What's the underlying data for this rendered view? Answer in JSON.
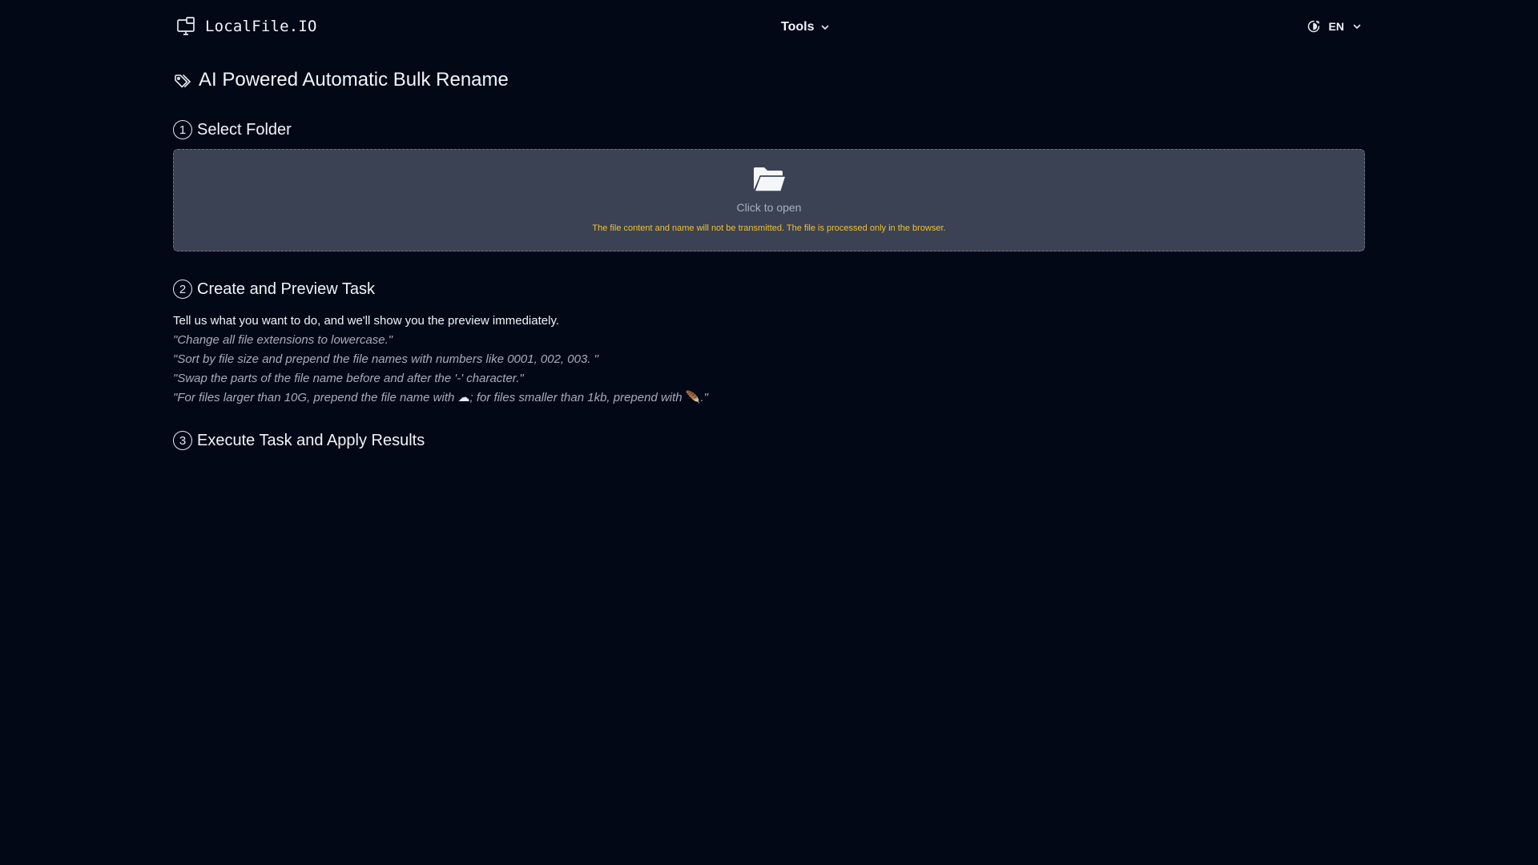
{
  "header": {
    "logo_text": "LocalFile.IO",
    "tools_label": "Tools",
    "language_label": "EN"
  },
  "main": {
    "title": "AI Powered Automatic Bulk Rename",
    "sections": [
      {
        "number": "1",
        "title": "Select Folder"
      },
      {
        "number": "2",
        "title": "Create and Preview Task"
      },
      {
        "number": "3",
        "title": "Execute Task and Apply Results"
      }
    ],
    "dropzone": {
      "label": "Click to open",
      "note": "The file content and name will not be transmitted. The file is processed only in the browser."
    },
    "task": {
      "intro": "Tell us what you want to do, and we'll show you the preview immediately.",
      "examples": [
        "\"Change all file extensions to lowercase.\"",
        "\"Sort by file size and prepend the file names with numbers like 0001, 002, 003. \"",
        "\"Swap the parts of the file name before and after the '-' character.\""
      ],
      "example4_before": "\"For files larger than 10G, prepend the file name with ",
      "example4_icon1": "☁",
      "example4_middle": "; for files smaller than 1kb, prepend with ",
      "example4_icon2": "🪶",
      "example4_after": ".\""
    }
  },
  "colors": {
    "background": "#030816",
    "dropzone": "#3a4253",
    "note": "#f2c12e",
    "example_text": "#a6adba"
  },
  "icons": {
    "logo": "computer-monitor-icon",
    "title": "tags-icon",
    "dropzone": "folder-open-icon",
    "language": "theme-toggle-icon",
    "chevron": "chevron-down-icon"
  }
}
